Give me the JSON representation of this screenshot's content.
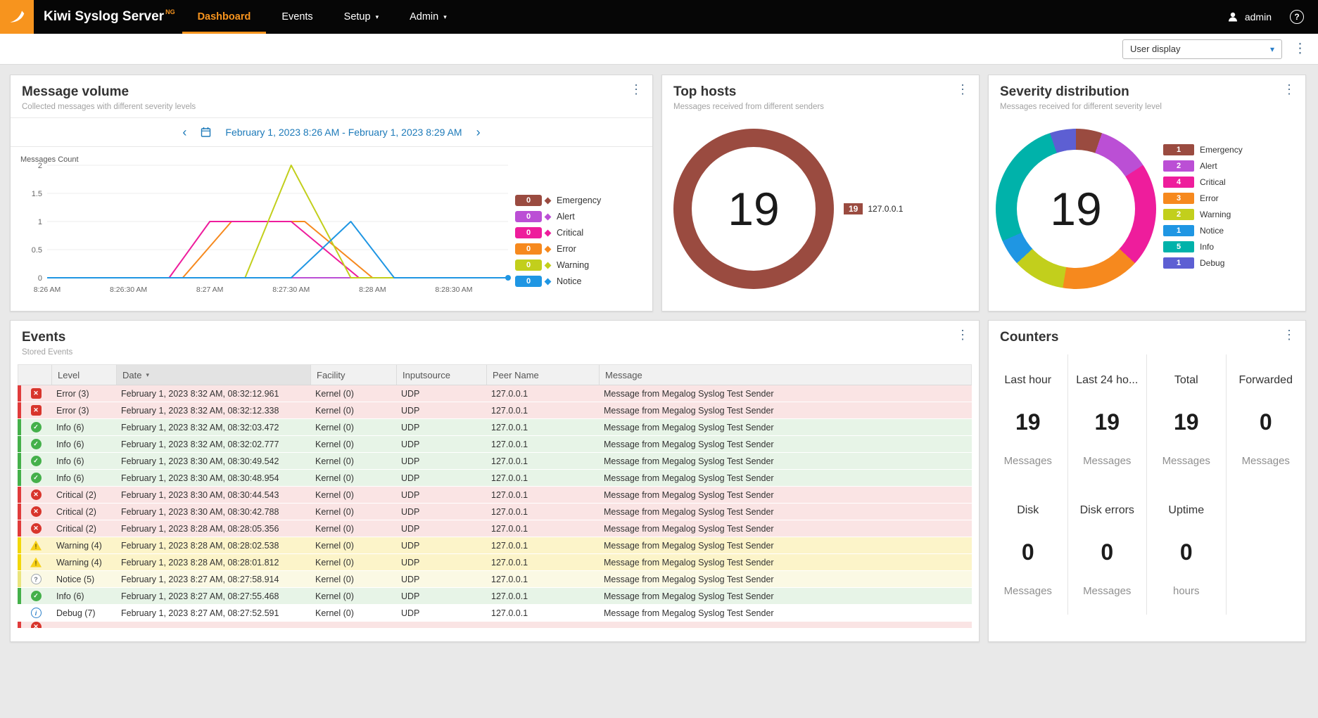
{
  "colors": {
    "accent_orange": "#f7941e",
    "link_blue": "#1d7ab9",
    "severity": {
      "emergency": "#9a4b40",
      "alert": "#bb4fd5",
      "critical": "#ee1d9c",
      "error": "#f6891e",
      "warning": "#c2cf1c",
      "notice": "#1f96e3",
      "info": "#00b2aa",
      "debug": "#5d5fd3"
    }
  },
  "icons": {
    "kebab": "⋮",
    "chev_left": "‹",
    "chev_right": "›",
    "caret_down": "▾",
    "sort_caret": "▾",
    "help": "?"
  },
  "topbar": {
    "brand": "Kiwi Syslog Server",
    "brand_sup": "NG",
    "nav": [
      {
        "label": "Dashboard",
        "active": true,
        "caret": false
      },
      {
        "label": "Events",
        "active": false,
        "caret": false
      },
      {
        "label": "Setup",
        "active": false,
        "caret": true
      },
      {
        "label": "Admin",
        "active": false,
        "caret": true
      }
    ],
    "user_label": "admin"
  },
  "toolbar": {
    "display_select": "User display"
  },
  "cards": {
    "message_volume": {
      "title": "Message volume",
      "subtitle": "Collected messages with different severity levels",
      "date_range": "February 1, 2023 8:26 AM - February 1, 2023 8:29 AM"
    },
    "top_hosts": {
      "title": "Top hosts",
      "subtitle": "Messages received from different senders"
    },
    "severity_distribution": {
      "title": "Severity distribution",
      "subtitle": "Messages received for different severity level"
    },
    "events": {
      "title": "Events",
      "subtitle": "Stored Events",
      "columns": [
        "Level",
        "Date",
        "Facility",
        "Inputsource",
        "Peer Name",
        "Message"
      ],
      "sort": {
        "column": "Date",
        "direction": "desc"
      },
      "rows": [
        {
          "severity": "error",
          "level": "Error (3)",
          "date": "February 1, 2023 8:32 AM, 08:32:12.961",
          "facility": "Kernel (0)",
          "inputsource": "UDP",
          "peer_name": "127.0.0.1",
          "message": "Message from Megalog Syslog Test Sender"
        },
        {
          "severity": "error",
          "level": "Error (3)",
          "date": "February 1, 2023 8:32 AM, 08:32:12.338",
          "facility": "Kernel (0)",
          "inputsource": "UDP",
          "peer_name": "127.0.0.1",
          "message": "Message from Megalog Syslog Test Sender"
        },
        {
          "severity": "info",
          "level": "Info (6)",
          "date": "February 1, 2023 8:32 AM, 08:32:03.472",
          "facility": "Kernel (0)",
          "inputsource": "UDP",
          "peer_name": "127.0.0.1",
          "message": "Message from Megalog Syslog Test Sender"
        },
        {
          "severity": "info",
          "level": "Info (6)",
          "date": "February 1, 2023 8:32 AM, 08:32:02.777",
          "facility": "Kernel (0)",
          "inputsource": "UDP",
          "peer_name": "127.0.0.1",
          "message": "Message from Megalog Syslog Test Sender"
        },
        {
          "severity": "info",
          "level": "Info (6)",
          "date": "February 1, 2023 8:30 AM, 08:30:49.542",
          "facility": "Kernel (0)",
          "inputsource": "UDP",
          "peer_name": "127.0.0.1",
          "message": "Message from Megalog Syslog Test Sender"
        },
        {
          "severity": "info",
          "level": "Info (6)",
          "date": "February 1, 2023 8:30 AM, 08:30:48.954",
          "facility": "Kernel (0)",
          "inputsource": "UDP",
          "peer_name": "127.0.0.1",
          "message": "Message from Megalog Syslog Test Sender"
        },
        {
          "severity": "critical",
          "level": "Critical (2)",
          "date": "February 1, 2023 8:30 AM, 08:30:44.543",
          "facility": "Kernel (0)",
          "inputsource": "UDP",
          "peer_name": "127.0.0.1",
          "message": "Message from Megalog Syslog Test Sender"
        },
        {
          "severity": "critical",
          "level": "Critical (2)",
          "date": "February 1, 2023 8:30 AM, 08:30:42.788",
          "facility": "Kernel (0)",
          "inputsource": "UDP",
          "peer_name": "127.0.0.1",
          "message": "Message from Megalog Syslog Test Sender"
        },
        {
          "severity": "critical",
          "level": "Critical (2)",
          "date": "February 1, 2023 8:28 AM, 08:28:05.356",
          "facility": "Kernel (0)",
          "inputsource": "UDP",
          "peer_name": "127.0.0.1",
          "message": "Message from Megalog Syslog Test Sender"
        },
        {
          "severity": "warning",
          "level": "Warning (4)",
          "date": "February 1, 2023 8:28 AM, 08:28:02.538",
          "facility": "Kernel (0)",
          "inputsource": "UDP",
          "peer_name": "127.0.0.1",
          "message": "Message from Megalog Syslog Test Sender"
        },
        {
          "severity": "warning",
          "level": "Warning (4)",
          "date": "February 1, 2023 8:28 AM, 08:28:01.812",
          "facility": "Kernel (0)",
          "inputsource": "UDP",
          "peer_name": "127.0.0.1",
          "message": "Message from Megalog Syslog Test Sender"
        },
        {
          "severity": "notice",
          "level": "Notice (5)",
          "date": "February 1, 2023 8:27 AM, 08:27:58.914",
          "facility": "Kernel (0)",
          "inputsource": "UDP",
          "peer_name": "127.0.0.1",
          "message": "Message from Megalog Syslog Test Sender"
        },
        {
          "severity": "info",
          "level": "Info (6)",
          "date": "February 1, 2023 8:27 AM, 08:27:55.468",
          "facility": "Kernel (0)",
          "inputsource": "UDP",
          "peer_name": "127.0.0.1",
          "message": "Message from Megalog Syslog Test Sender"
        },
        {
          "severity": "debug",
          "level": "Debug (7)",
          "date": "February 1, 2023 8:27 AM, 08:27:52.591",
          "facility": "Kernel (0)",
          "inputsource": "UDP",
          "peer_name": "127.0.0.1",
          "message": "Message from Megalog Syslog Test Sender"
        }
      ],
      "partial_row": {
        "severity": "critical"
      }
    },
    "counters": {
      "title": "Counters",
      "items": [
        {
          "label": "Last hour",
          "value": "19",
          "unit": "Messages"
        },
        {
          "label": "Last 24 ho...",
          "value": "19",
          "unit": "Messages"
        },
        {
          "label": "Total",
          "value": "19",
          "unit": "Messages"
        },
        {
          "label": "Forwarded",
          "value": "0",
          "unit": "Messages"
        },
        {
          "label": "Disk",
          "value": "0",
          "unit": "Messages"
        },
        {
          "label": "Disk errors",
          "value": "0",
          "unit": "Messages"
        },
        {
          "label": "Uptime",
          "value": "0",
          "unit": "hours"
        }
      ]
    }
  },
  "chart_data": [
    {
      "type": "line",
      "title": "Message volume",
      "ylabel": "Messages Count",
      "ylim": [
        0,
        2
      ],
      "yticks": [
        0,
        0.5,
        1,
        1.5,
        2
      ],
      "xticks": [
        "8:26 AM",
        "8:26:30 AM",
        "8:27 AM",
        "8:27:30 AM",
        "8:28 AM",
        "8:28:30 AM"
      ],
      "xtick_seconds": [
        0,
        30,
        60,
        90,
        120,
        150
      ],
      "x_domain_seconds": [
        0,
        170
      ],
      "grid": true,
      "legend_position": "right",
      "draw_order": [
        0,
        1,
        3,
        2,
        4,
        5
      ],
      "series": [
        {
          "name": "Emergency",
          "count": 0,
          "color_key": "emergency",
          "points": [
            [
              0,
              0
            ],
            [
              170,
              0
            ]
          ]
        },
        {
          "name": "Alert",
          "count": 0,
          "color_key": "alert",
          "points": [
            [
              0,
              0
            ],
            [
              170,
              0
            ]
          ]
        },
        {
          "name": "Critical",
          "count": 0,
          "color_key": "critical",
          "points": [
            [
              0,
              0
            ],
            [
              45,
              0
            ],
            [
              60,
              1
            ],
            [
              90,
              1
            ],
            [
              115,
              0
            ],
            [
              170,
              0
            ]
          ]
        },
        {
          "name": "Error",
          "count": 0,
          "color_key": "error",
          "points": [
            [
              0,
              0
            ],
            [
              50,
              0
            ],
            [
              68,
              1
            ],
            [
              95,
              1
            ],
            [
              120,
              0
            ],
            [
              170,
              0
            ]
          ]
        },
        {
          "name": "Warning",
          "count": 0,
          "color_key": "warning",
          "points": [
            [
              0,
              0
            ],
            [
              73,
              0
            ],
            [
              90,
              2
            ],
            [
              112,
              0
            ],
            [
              170,
              0
            ]
          ]
        },
        {
          "name": "Notice",
          "count": 0,
          "color_key": "notice",
          "points": [
            [
              0,
              0
            ],
            [
              90,
              0
            ],
            [
              112,
              1
            ],
            [
              128,
              0
            ],
            [
              170,
              0
            ]
          ],
          "end_dot": true
        }
      ]
    },
    {
      "type": "pie",
      "title": "Top hosts",
      "center_total": 19,
      "segments": [
        {
          "label": "127.0.0.1",
          "value": 19,
          "color_key": "emergency"
        }
      ]
    },
    {
      "type": "pie",
      "title": "Severity distribution",
      "center_total": 19,
      "segments": [
        {
          "label": "Emergency",
          "value": 1,
          "color_key": "emergency"
        },
        {
          "label": "Alert",
          "value": 2,
          "color_key": "alert"
        },
        {
          "label": "Critical",
          "value": 4,
          "color_key": "critical"
        },
        {
          "label": "Error",
          "value": 3,
          "color_key": "error"
        },
        {
          "label": "Warning",
          "value": 2,
          "color_key": "warning"
        },
        {
          "label": "Notice",
          "value": 1,
          "color_key": "notice"
        },
        {
          "label": "Info",
          "value": 5,
          "color_key": "info"
        },
        {
          "label": "Debug",
          "value": 1,
          "color_key": "debug"
        }
      ]
    }
  ]
}
